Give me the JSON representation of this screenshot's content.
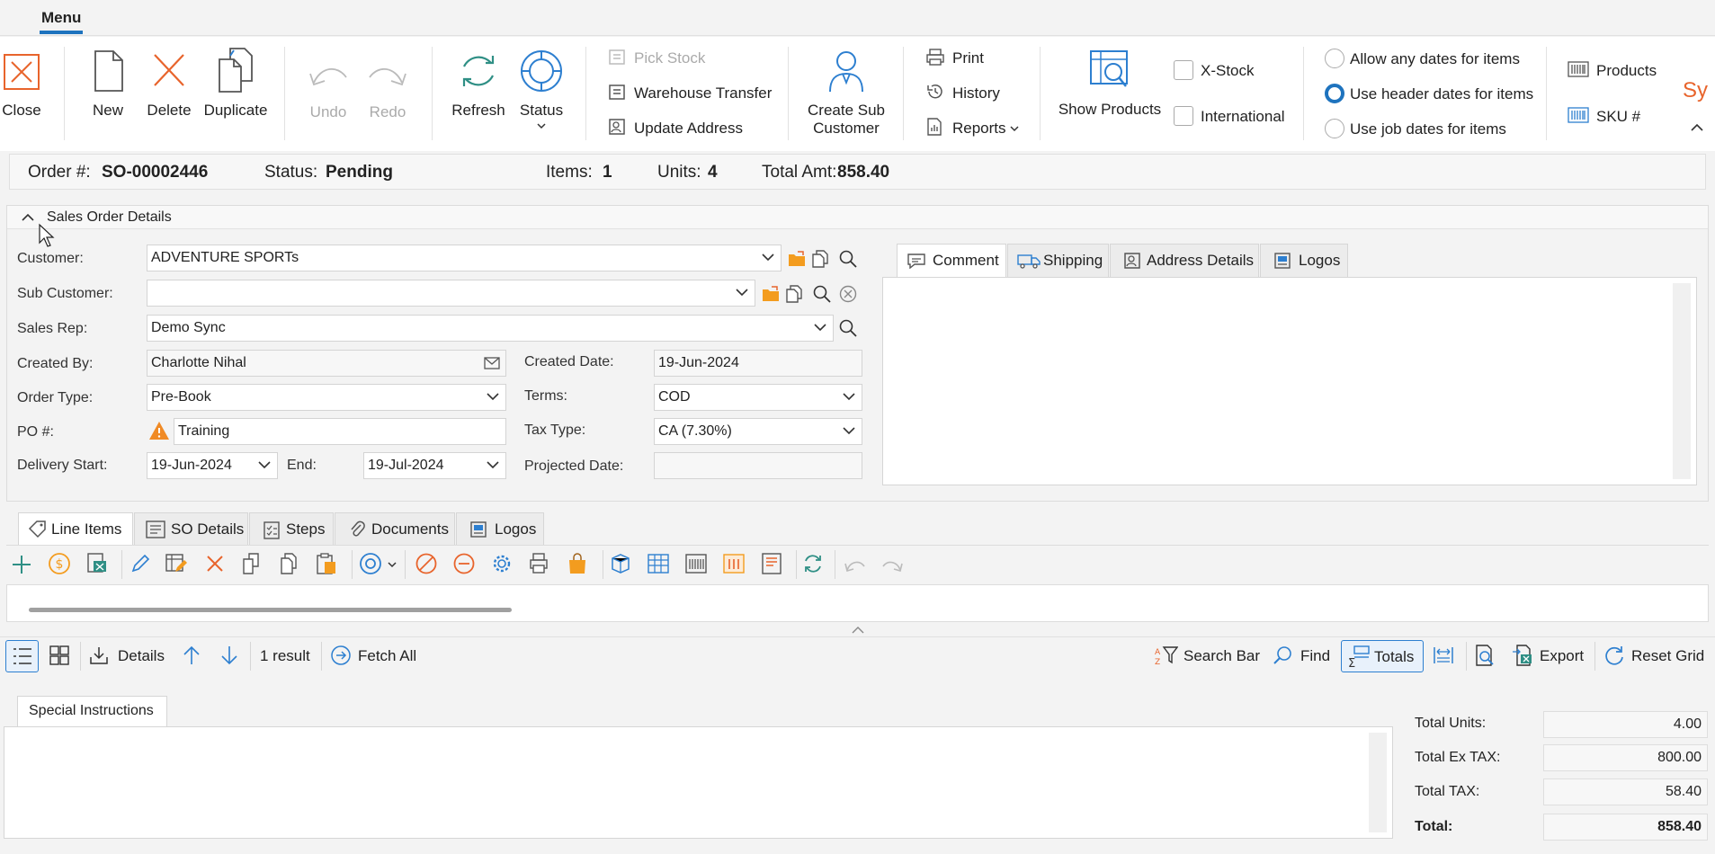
{
  "menu": {
    "label": "Menu"
  },
  "ribbon": {
    "close": "Close",
    "new": "New",
    "delete": "Delete",
    "duplicate": "Duplicate",
    "undo": "Undo",
    "redo": "Redo",
    "refresh": "Refresh",
    "status": "Status",
    "pick_stock": "Pick Stock",
    "warehouse_transfer": "Warehouse Transfer",
    "update_address": "Update Address",
    "create_sub_customer_1": "Create Sub",
    "create_sub_customer_2": "Customer",
    "print": "Print",
    "history": "History",
    "reports": "Reports",
    "show_products": "Show Products",
    "x_stock": "X-Stock",
    "international": "International",
    "allow_any_dates": "Allow any dates for items",
    "use_header_dates": "Use header dates for items",
    "use_job_dates": "Use job dates for items",
    "products": "Products",
    "sku": "SKU #",
    "brand_partial": "Sy"
  },
  "header": {
    "order_label": "Order #:",
    "order_value": "SO-00002446",
    "status_label": "Status:",
    "status_value": "Pending",
    "items_label": "Items:",
    "items_value": "1",
    "units_label": "Units:",
    "units_value": "4",
    "total_label": "Total Amt:",
    "total_value": "858.40"
  },
  "details": {
    "section_title": "Sales Order Details",
    "customer_label": "Customer:",
    "customer_value": "ADVENTURE SPORTs",
    "sub_customer_label": "Sub Customer:",
    "sub_customer_value": "",
    "sales_rep_label": "Sales Rep:",
    "sales_rep_value": "Demo Sync",
    "created_by_label": "Created By:",
    "created_by_value": "Charlotte Nihal",
    "created_date_label": "Created Date:",
    "created_date_value": "19-Jun-2024",
    "order_type_label": "Order Type:",
    "order_type_value": "Pre-Book",
    "terms_label": "Terms:",
    "terms_value": "COD",
    "po_label": "PO #:",
    "po_value": "Training",
    "tax_type_label": "Tax Type:",
    "tax_type_value": "CA (7.30%)",
    "delivery_start_label": "Delivery Start:",
    "delivery_start_value": "19-Jun-2024",
    "end_label": "End:",
    "end_value": "19-Jul-2024",
    "projected_date_label": "Projected Date:",
    "projected_date_value": ""
  },
  "right_tabs": [
    "Comment",
    "Shipping",
    "Address Details",
    "Logos"
  ],
  "line_tabs": [
    "Line Items",
    "SO Details",
    "Steps",
    "Documents",
    "Logos"
  ],
  "grid_toolbar": {
    "details": "Details",
    "result": "1 result",
    "fetch_all": "Fetch All",
    "search_bar": "Search Bar",
    "find": "Find",
    "totals": "Totals",
    "export": "Export",
    "reset_grid": "Reset Grid"
  },
  "special_instructions": {
    "tab": "Special Instructions"
  },
  "totals": {
    "units_label": "Total Units:",
    "units_value": "4.00",
    "ex_tax_label": "Total Ex TAX:",
    "ex_tax_value": "800.00",
    "tax_label": "Total TAX:",
    "tax_value": "58.40",
    "total_label": "Total:",
    "total_value": "858.40"
  },
  "colors": {
    "accent": "#1e73be",
    "delete_red": "#e8642c",
    "orange_icon": "#f39c1f",
    "blue_icon": "#2d7fd0"
  }
}
